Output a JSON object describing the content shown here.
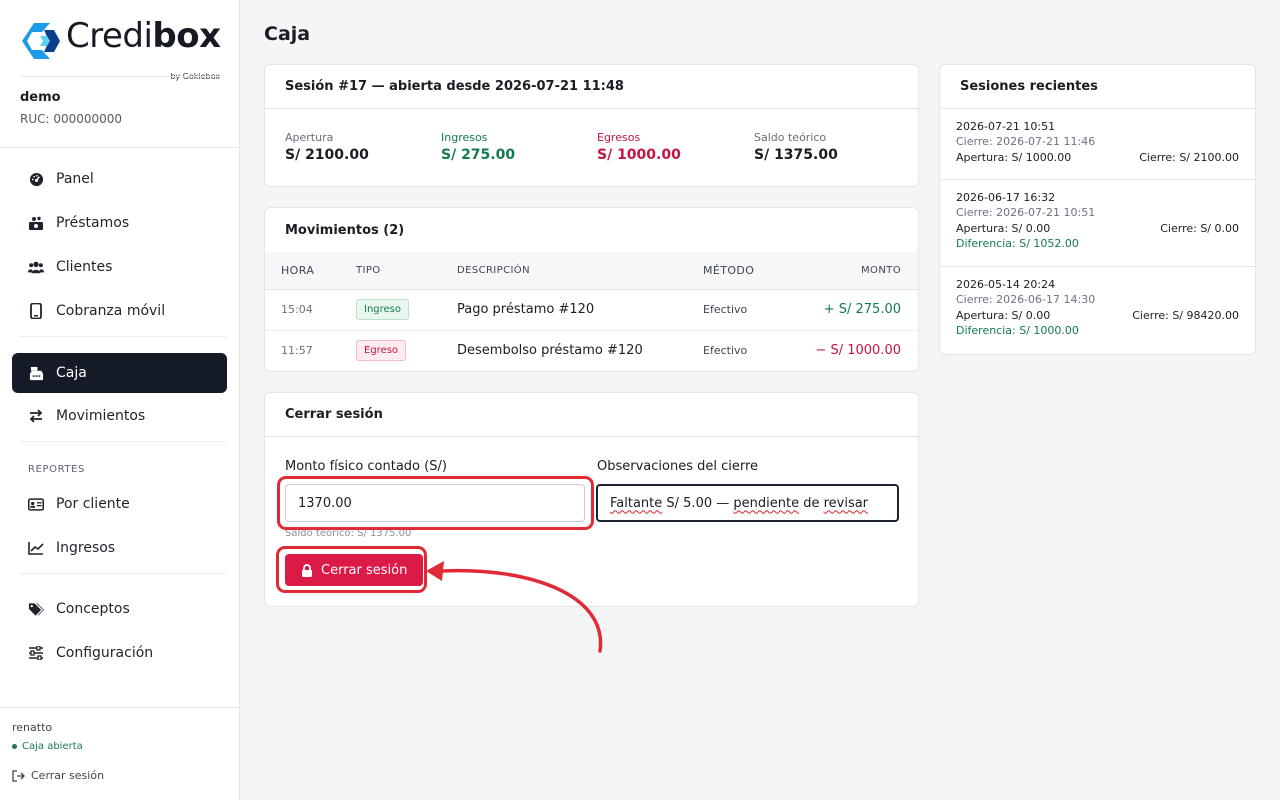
{
  "brand": {
    "name_light": "Credi",
    "name_bold": "box",
    "sub": "by Gokiebox"
  },
  "org": {
    "name": "demo",
    "ruc": "RUC: 000000000"
  },
  "nav": {
    "items": [
      {
        "label": "Panel",
        "icon": "gauge-icon"
      },
      {
        "label": "Préstamos",
        "icon": "money-icon"
      },
      {
        "label": "Clientes",
        "icon": "users-icon"
      },
      {
        "label": "Cobranza móvil",
        "icon": "phone-icon"
      },
      {
        "label": "Caja",
        "icon": "cash-register-icon",
        "active": true
      },
      {
        "label": "Movimientos",
        "icon": "arrows-icon"
      }
    ],
    "section_reportes": "REPORTES",
    "reportes": [
      {
        "label": "Por cliente",
        "icon": "id-card-icon"
      },
      {
        "label": "Ingresos",
        "icon": "chart-line-icon"
      }
    ],
    "extra": [
      {
        "label": "Conceptos",
        "icon": "tags-icon"
      },
      {
        "label": "Configuración",
        "icon": "sliders-icon"
      }
    ]
  },
  "footer": {
    "user": "renatto",
    "caja_status": "Caja abierta",
    "logout": "Cerrar sesión"
  },
  "page": {
    "title": "Caja"
  },
  "session": {
    "title": "Sesión #17 — abierta desde 2026-07-21 11:48",
    "stats": [
      {
        "label": "Apertura",
        "value": "S/ 2100.00"
      },
      {
        "label": "Ingresos",
        "value": "S/ 275.00"
      },
      {
        "label": "Egresos",
        "value": "S/ 1000.00"
      },
      {
        "label": "Saldo teórico",
        "value": "S/ 1375.00"
      }
    ]
  },
  "movimientos": {
    "title": "Movimientos (2)",
    "columns": [
      "HORA",
      "TIPO",
      "DESCRIPCIÓN",
      "MÉTODO",
      "MONTO"
    ],
    "rows": [
      {
        "hora": "15:04",
        "tipo": "Ingreso",
        "descripcion": "Pago préstamo #120",
        "metodo": "Efectivo",
        "monto": "+ S/ 275.00"
      },
      {
        "hora": "11:57",
        "tipo": "Egreso",
        "descripcion": "Desembolso préstamo #120",
        "metodo": "Efectivo",
        "monto": "− S/ 1000.00"
      }
    ]
  },
  "cerrar": {
    "title": "Cerrar sesión",
    "monto_label": "Monto físico contado (S/)",
    "monto_value": "1370.00",
    "obs_label": "Observaciones del cierre",
    "obs_value_a": "Faltante",
    "obs_value_b": " S/ 5.00 — ",
    "obs_value_c": "pendiente",
    "obs_value_d": " de ",
    "obs_value_e": "revisar",
    "hint": "Saldo teórico: S/ 1375.00",
    "button": "Cerrar sesión"
  },
  "recientes": {
    "title": "Sesiones recientes",
    "items": [
      {
        "date": "2026-07-21 10:51",
        "cierre": "Cierre: 2026-07-21 11:46",
        "apertura": "Apertura: S/ 1000.00",
        "cierre_monto": "Cierre: S/ 2100.00",
        "diferencia": ""
      },
      {
        "date": "2026-06-17 16:32",
        "cierre": "Cierre: 2026-07-21 10:51",
        "apertura": "Apertura: S/ 0.00",
        "cierre_monto": "Cierre: S/ 0.00",
        "diferencia": "Diferencia: S/ 1052.00"
      },
      {
        "date": "2026-05-14 20:24",
        "cierre": "Cierre: 2026-06-17 14:30",
        "apertura": "Apertura: S/ 0.00",
        "cierre_monto": "Cierre: S/ 98420.00",
        "diferencia": "Diferencia: S/ 1000.00"
      }
    ]
  },
  "colors": {
    "accent_dark": "#141a26",
    "danger": "#dc1a48",
    "success": "#147a4d",
    "logo_blue": "#1e9be6",
    "annotation": "#e02b36"
  }
}
